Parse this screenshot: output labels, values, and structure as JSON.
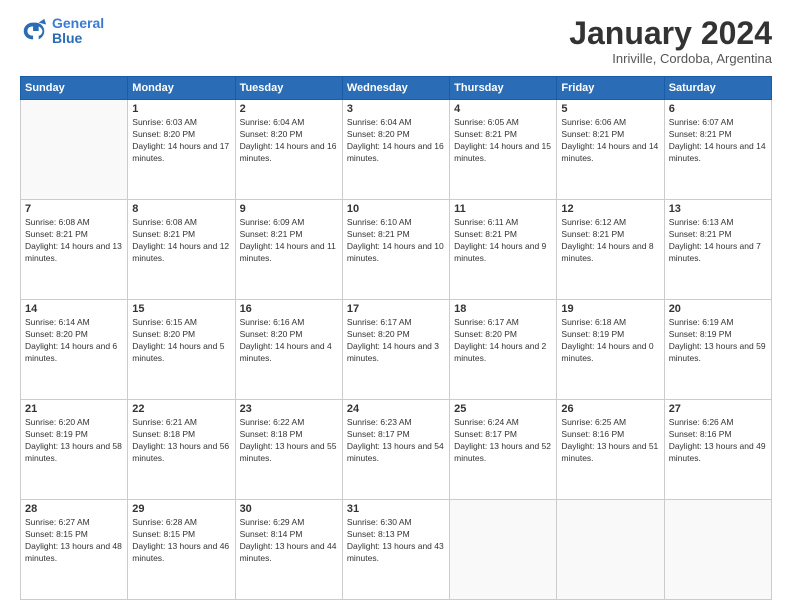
{
  "header": {
    "logo_line1": "General",
    "logo_line2": "Blue",
    "month": "January 2024",
    "location": "Inriville, Cordoba, Argentina"
  },
  "weekdays": [
    "Sunday",
    "Monday",
    "Tuesday",
    "Wednesday",
    "Thursday",
    "Friday",
    "Saturday"
  ],
  "weeks": [
    [
      {
        "day": "",
        "sunrise": "",
        "sunset": "",
        "daylight": ""
      },
      {
        "day": "1",
        "sunrise": "6:03 AM",
        "sunset": "8:20 PM",
        "daylight": "14 hours and 17 minutes."
      },
      {
        "day": "2",
        "sunrise": "6:04 AM",
        "sunset": "8:20 PM",
        "daylight": "14 hours and 16 minutes."
      },
      {
        "day": "3",
        "sunrise": "6:04 AM",
        "sunset": "8:20 PM",
        "daylight": "14 hours and 16 minutes."
      },
      {
        "day": "4",
        "sunrise": "6:05 AM",
        "sunset": "8:21 PM",
        "daylight": "14 hours and 15 minutes."
      },
      {
        "day": "5",
        "sunrise": "6:06 AM",
        "sunset": "8:21 PM",
        "daylight": "14 hours and 14 minutes."
      },
      {
        "day": "6",
        "sunrise": "6:07 AM",
        "sunset": "8:21 PM",
        "daylight": "14 hours and 14 minutes."
      }
    ],
    [
      {
        "day": "7",
        "sunrise": "6:08 AM",
        "sunset": "8:21 PM",
        "daylight": "14 hours and 13 minutes."
      },
      {
        "day": "8",
        "sunrise": "6:08 AM",
        "sunset": "8:21 PM",
        "daylight": "14 hours and 12 minutes."
      },
      {
        "day": "9",
        "sunrise": "6:09 AM",
        "sunset": "8:21 PM",
        "daylight": "14 hours and 11 minutes."
      },
      {
        "day": "10",
        "sunrise": "6:10 AM",
        "sunset": "8:21 PM",
        "daylight": "14 hours and 10 minutes."
      },
      {
        "day": "11",
        "sunrise": "6:11 AM",
        "sunset": "8:21 PM",
        "daylight": "14 hours and 9 minutes."
      },
      {
        "day": "12",
        "sunrise": "6:12 AM",
        "sunset": "8:21 PM",
        "daylight": "14 hours and 8 minutes."
      },
      {
        "day": "13",
        "sunrise": "6:13 AM",
        "sunset": "8:21 PM",
        "daylight": "14 hours and 7 minutes."
      }
    ],
    [
      {
        "day": "14",
        "sunrise": "6:14 AM",
        "sunset": "8:20 PM",
        "daylight": "14 hours and 6 minutes."
      },
      {
        "day": "15",
        "sunrise": "6:15 AM",
        "sunset": "8:20 PM",
        "daylight": "14 hours and 5 minutes."
      },
      {
        "day": "16",
        "sunrise": "6:16 AM",
        "sunset": "8:20 PM",
        "daylight": "14 hours and 4 minutes."
      },
      {
        "day": "17",
        "sunrise": "6:17 AM",
        "sunset": "8:20 PM",
        "daylight": "14 hours and 3 minutes."
      },
      {
        "day": "18",
        "sunrise": "6:17 AM",
        "sunset": "8:20 PM",
        "daylight": "14 hours and 2 minutes."
      },
      {
        "day": "19",
        "sunrise": "6:18 AM",
        "sunset": "8:19 PM",
        "daylight": "14 hours and 0 minutes."
      },
      {
        "day": "20",
        "sunrise": "6:19 AM",
        "sunset": "8:19 PM",
        "daylight": "13 hours and 59 minutes."
      }
    ],
    [
      {
        "day": "21",
        "sunrise": "6:20 AM",
        "sunset": "8:19 PM",
        "daylight": "13 hours and 58 minutes."
      },
      {
        "day": "22",
        "sunrise": "6:21 AM",
        "sunset": "8:18 PM",
        "daylight": "13 hours and 56 minutes."
      },
      {
        "day": "23",
        "sunrise": "6:22 AM",
        "sunset": "8:18 PM",
        "daylight": "13 hours and 55 minutes."
      },
      {
        "day": "24",
        "sunrise": "6:23 AM",
        "sunset": "8:17 PM",
        "daylight": "13 hours and 54 minutes."
      },
      {
        "day": "25",
        "sunrise": "6:24 AM",
        "sunset": "8:17 PM",
        "daylight": "13 hours and 52 minutes."
      },
      {
        "day": "26",
        "sunrise": "6:25 AM",
        "sunset": "8:16 PM",
        "daylight": "13 hours and 51 minutes."
      },
      {
        "day": "27",
        "sunrise": "6:26 AM",
        "sunset": "8:16 PM",
        "daylight": "13 hours and 49 minutes."
      }
    ],
    [
      {
        "day": "28",
        "sunrise": "6:27 AM",
        "sunset": "8:15 PM",
        "daylight": "13 hours and 48 minutes."
      },
      {
        "day": "29",
        "sunrise": "6:28 AM",
        "sunset": "8:15 PM",
        "daylight": "13 hours and 46 minutes."
      },
      {
        "day": "30",
        "sunrise": "6:29 AM",
        "sunset": "8:14 PM",
        "daylight": "13 hours and 44 minutes."
      },
      {
        "day": "31",
        "sunrise": "6:30 AM",
        "sunset": "8:13 PM",
        "daylight": "13 hours and 43 minutes."
      },
      {
        "day": "",
        "sunrise": "",
        "sunset": "",
        "daylight": ""
      },
      {
        "day": "",
        "sunrise": "",
        "sunset": "",
        "daylight": ""
      },
      {
        "day": "",
        "sunrise": "",
        "sunset": "",
        "daylight": ""
      }
    ]
  ]
}
